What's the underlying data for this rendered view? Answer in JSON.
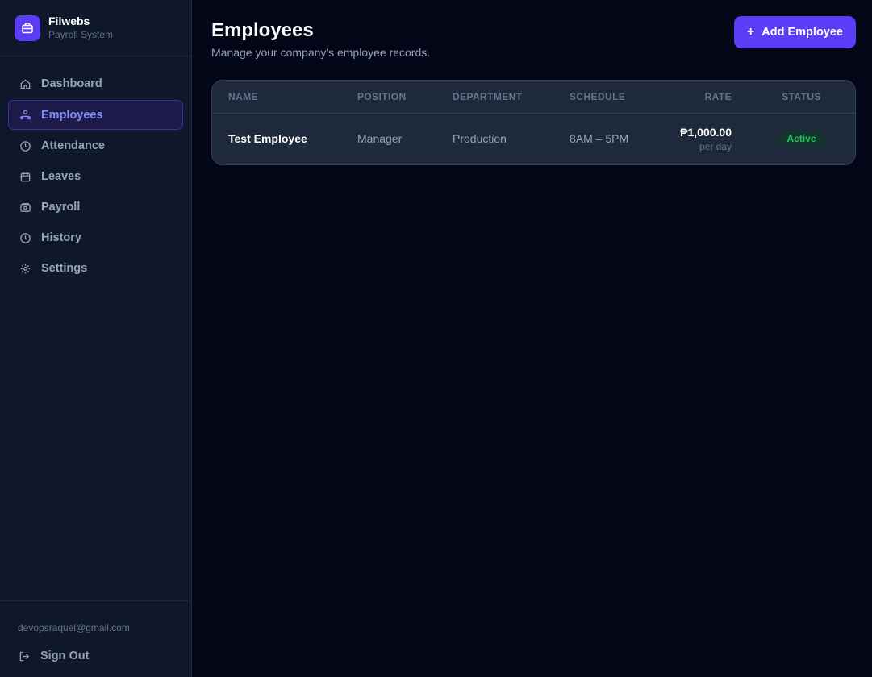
{
  "brand": {
    "name": "Filwebs",
    "subtitle": "Payroll System",
    "logo_icon": "briefcase-icon",
    "accent": "#5b3df5"
  },
  "nav": {
    "items": [
      {
        "label": "Dashboard",
        "icon": "home-icon"
      },
      {
        "label": "Employees",
        "icon": "users-icon",
        "active": true
      },
      {
        "label": "Attendance",
        "icon": "clock-icon"
      },
      {
        "label": "Leaves",
        "icon": "calendar-icon"
      },
      {
        "label": "Payroll",
        "icon": "wallet-icon"
      },
      {
        "label": "History",
        "icon": "history-icon"
      },
      {
        "label": "Settings",
        "icon": "gear-icon"
      }
    ]
  },
  "footer": {
    "email": "devopsraquel@gmail.com",
    "signout_label": "Sign Out"
  },
  "page": {
    "title": "Employees",
    "subtitle": "Manage your company's employee records.",
    "add_button_label": "Add Employee"
  },
  "table": {
    "columns": [
      "NAME",
      "POSITION",
      "DEPARTMENT",
      "SCHEDULE",
      "RATE",
      "STATUS"
    ],
    "rows": [
      {
        "name": "Test Employee",
        "position": "Manager",
        "department": "Production",
        "schedule": "8AM – 5PM",
        "rate": "₱1,000.00",
        "rate_unit": "per day",
        "status": "Active",
        "status_color": "#22c55e"
      }
    ]
  }
}
